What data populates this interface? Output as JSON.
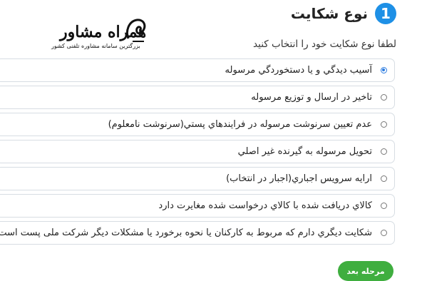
{
  "step": {
    "number": "1",
    "title": "نوع شکايت"
  },
  "watermark": {
    "brand": "همراه مشاور",
    "tagline": "بزرگترین سامانه مشاوره تلفنی کشور"
  },
  "instruction": "لطفا نوع شکايت خود را انتخاب کنيد",
  "options": [
    {
      "label": "آسيب ديدگي و يا دستخوردگي مرسوله",
      "selected": true
    },
    {
      "label": "تاخير در ارسال و توزيع مرسوله",
      "selected": false
    },
    {
      "label": "عدم تعيين سرنوشت مرسوله در فرايندهاي پستي(سرنوشت نامعلوم)",
      "selected": false
    },
    {
      "label": "تحويل مرسوله به گيرنده غير اصلي",
      "selected": false
    },
    {
      "label": "ارايه سرويس اجباري(اجبار در انتخاب)",
      "selected": false
    },
    {
      "label": "کالاي دريافت شده با کالاي درخواست شده مغايرت دارد",
      "selected": false
    },
    {
      "label": "شکايت ديگري دارم که مربوط به کارکنان يا نحوه برخورد يا مشکلات ديگر شرکت ملی پست است",
      "selected": false
    }
  ],
  "next_button": "مرحله بعد",
  "colors": {
    "accent": "#1e90e6",
    "radio_selected": "#2b7be0",
    "button": "#3fae3f"
  }
}
